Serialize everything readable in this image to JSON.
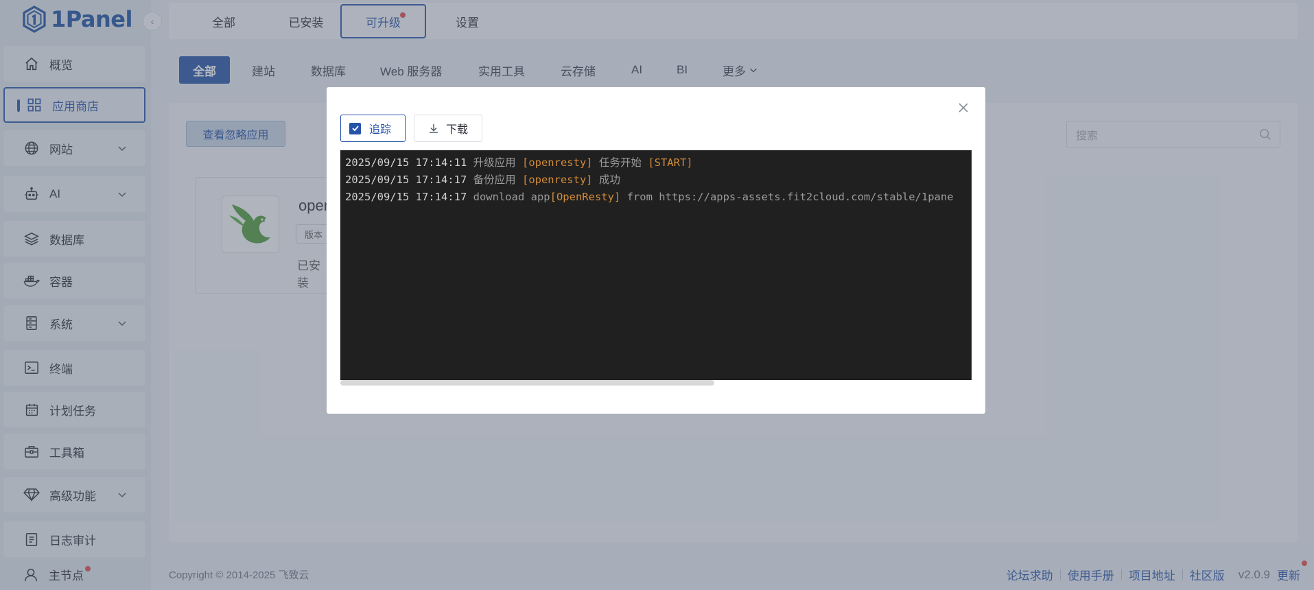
{
  "brand": {
    "name": "1Panel"
  },
  "sidebar": {
    "collapse_glyph": "‹",
    "items": [
      {
        "label": "概览",
        "icon": "home-icon"
      },
      {
        "label": "应用商店",
        "icon": "grid-icon",
        "active": true
      },
      {
        "label": "网站",
        "icon": "globe-icon",
        "expandable": true
      },
      {
        "label": "AI",
        "icon": "robot-icon",
        "expandable": true
      },
      {
        "label": "数据库",
        "icon": "layers-icon"
      },
      {
        "label": "容器",
        "icon": "docker-icon"
      },
      {
        "label": "系统",
        "icon": "server-icon",
        "expandable": true
      },
      {
        "label": "终端",
        "icon": "terminal-icon"
      },
      {
        "label": "计划任务",
        "icon": "calendar-icon"
      },
      {
        "label": "工具箱",
        "icon": "toolbox-icon"
      },
      {
        "label": "高级功能",
        "icon": "diamond-icon",
        "expandable": true
      },
      {
        "label": "日志审计",
        "icon": "log-icon"
      }
    ],
    "node": {
      "label": "主节点",
      "icon": "user-icon"
    }
  },
  "top_tabs": [
    {
      "label": "全部"
    },
    {
      "label": "已安装"
    },
    {
      "label": "可升级",
      "active": true,
      "badge": true
    },
    {
      "label": "设置"
    }
  ],
  "categories": [
    "全部",
    "建站",
    "数据库",
    "Web 服务器",
    "实用工具",
    "云存储",
    "AI",
    "BI",
    "更多"
  ],
  "toolbar": {
    "ignore_label": "查看忽略应用",
    "search_placeholder": "搜索"
  },
  "app_card": {
    "name": "oper",
    "version_label": "版本",
    "installed_label": "已安装"
  },
  "footer": {
    "copyright": "Copyright © 2014-2025 飞致云",
    "links": [
      "论坛求助",
      "使用手册",
      "项目地址",
      "社区版"
    ],
    "version": "v2.0.9",
    "update": "更新"
  },
  "dialog": {
    "follow_label": "追踪",
    "follow_checked": true,
    "download_label": "下载",
    "close_glyph": "✕",
    "log": [
      {
        "time": "2025/09/15 17:14:11",
        "parts": [
          {
            "text": " 升级应用 ",
            "hl": false
          },
          {
            "text": "[openresty]",
            "hl": true
          },
          {
            "text": " 任务开始 ",
            "hl": false
          },
          {
            "text": "[START]",
            "hl": true
          }
        ]
      },
      {
        "time": "2025/09/15 17:14:17",
        "parts": [
          {
            "text": " 备份应用 ",
            "hl": false
          },
          {
            "text": "[openresty]",
            "hl": true
          },
          {
            "text": " 成功",
            "hl": false
          }
        ]
      },
      {
        "time": "2025/09/15 17:14:17",
        "parts": [
          {
            "text": " download app",
            "hl": false
          },
          {
            "text": "[OpenResty]",
            "hl": true
          },
          {
            "text": " from https://apps-assets.fit2cloud.com/stable/1pane",
            "hl": false
          }
        ]
      }
    ]
  },
  "colors": {
    "accent": "#2553a8",
    "badge": "#e04a4a",
    "terminal_bg": "#202020",
    "log_highlight": "#d18b3a"
  }
}
